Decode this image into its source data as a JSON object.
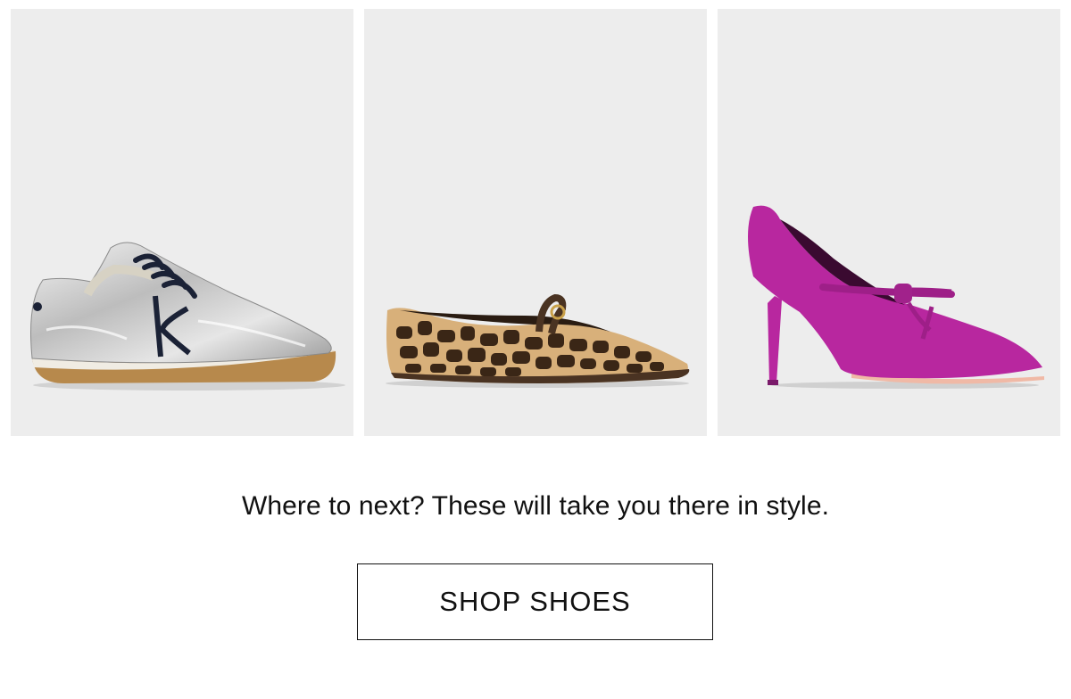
{
  "products": [
    {
      "name": "sneaker",
      "icon": "silver-sneaker-image",
      "colors": {
        "upper": "#c9c9c9",
        "sole": "#b7894c",
        "laces": "#1b2236"
      }
    },
    {
      "name": "ballet-flat",
      "icon": "leopard-ballet-flat-image",
      "colors": {
        "base": "#d8b07a",
        "spots": "#3a2616",
        "strap": "#4a3322"
      }
    },
    {
      "name": "pump",
      "icon": "magenta-suede-pump-image",
      "colors": {
        "suede": "#b8279f",
        "sole": "#f0b9a6"
      }
    }
  ],
  "headline": "Where to next? These will take you there in style.",
  "cta": {
    "label": "SHOP SHOES"
  }
}
